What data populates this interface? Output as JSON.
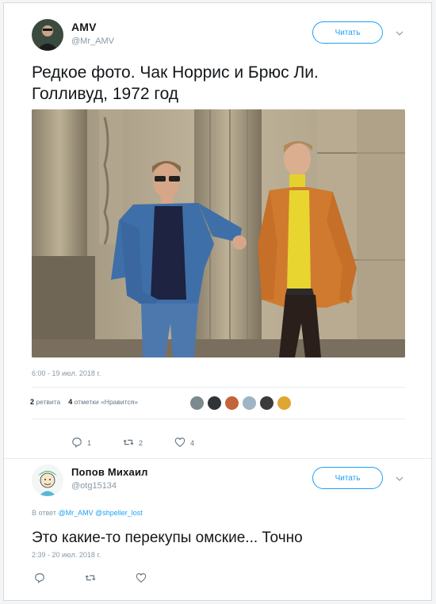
{
  "tweet": {
    "author_name": "AMV",
    "author_handle": "@Mr_AMV",
    "follow_label": "Читать",
    "text_line1": "Редкое фото. Чак Норрис и Брюс Ли.",
    "text_line2": "Голливуд, 1972 год",
    "timestamp": "6:00 - 19 июл. 2018 г.",
    "retweets_count": "2",
    "retweets_label": "ретвита",
    "likes_count": "4",
    "likes_label": "отметки «Нравится»",
    "reply_count": "1",
    "retweet_count_action": "2",
    "like_count_action": "4"
  },
  "reply": {
    "author_name": "Попов Михаил",
    "author_handle": "@otg15134",
    "follow_label": "Читать",
    "reply_prefix": "В ответ",
    "mention1": "@Mr_AMV",
    "mention2": "@shpeller_lost",
    "text": "Это какие-то перекупы омские... Точно",
    "timestamp": "2:39 - 20 июл. 2018 г."
  },
  "colors": {
    "accent": "#1da1f2",
    "secondary_text": "#8899a6",
    "divider": "#e6ecf0"
  },
  "icons": [
    "caret-down-icon",
    "reply-icon",
    "retweet-icon",
    "heart-icon"
  ]
}
